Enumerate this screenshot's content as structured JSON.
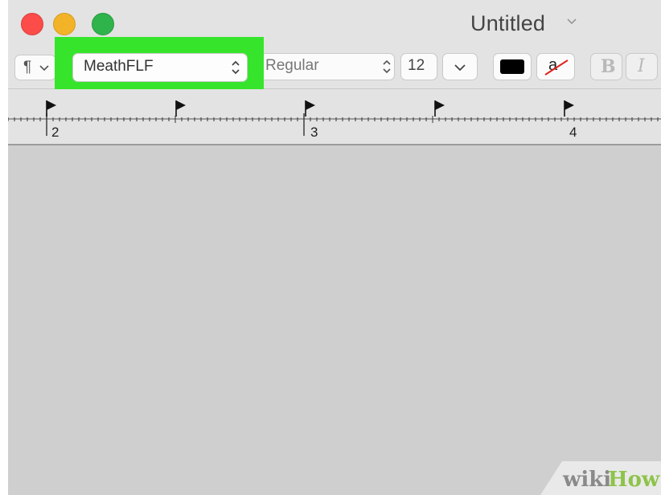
{
  "window": {
    "title": "Untitled",
    "traffic_lights": [
      "close",
      "minimize",
      "zoom"
    ]
  },
  "toolbar": {
    "paragraph_glyph": "¶",
    "font_name": "MeathFLF",
    "font_style": "Regular",
    "font_size": "12",
    "text_color": "#000000",
    "highlight_glyph": "a",
    "bold_label": "B",
    "italic_label": "I"
  },
  "ruler": {
    "labels": [
      "2",
      "3",
      "4"
    ]
  },
  "annotation": {
    "highlight_color": "#36e52b"
  },
  "watermark": {
    "part1": "wiki",
    "part2": "How"
  }
}
